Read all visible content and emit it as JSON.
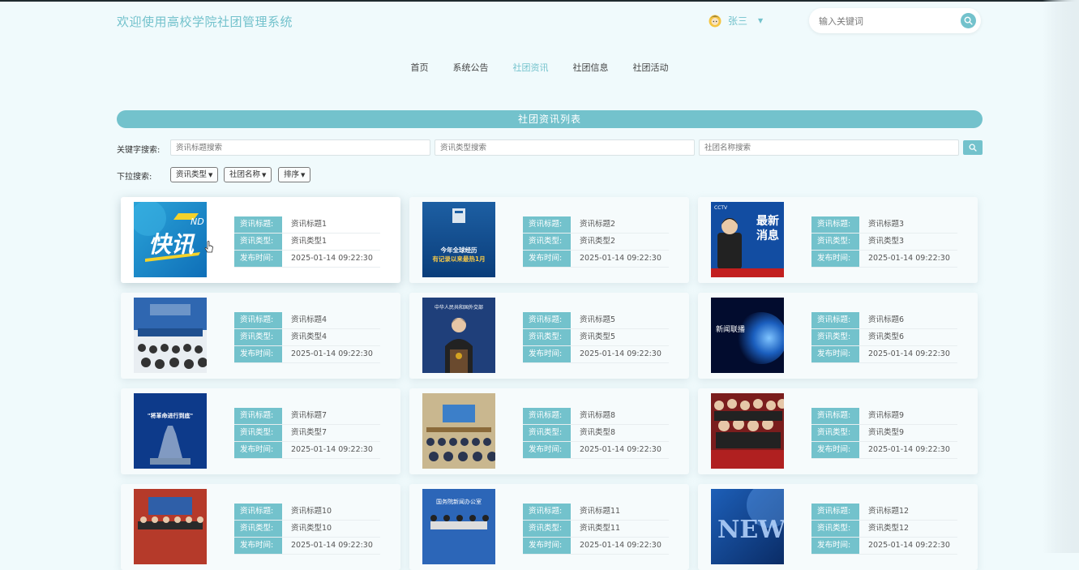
{
  "header": {
    "site_title": "欢迎使用高校学院社团管理系统",
    "user_name": "张三",
    "search_placeholder": "输入关键词"
  },
  "nav": {
    "items": [
      "首页",
      "系统公告",
      "社团资讯",
      "社团信息",
      "社团活动"
    ],
    "active": "社团资讯"
  },
  "section_title": "社团资讯列表",
  "filters": {
    "keyword_label": "关键字搜索:",
    "title_placeholder": "资讯标题搜索",
    "type_placeholder": "资讯类型搜索",
    "club_placeholder": "社团名称搜索",
    "dropdown_label": "下拉搜索:",
    "dropdowns": [
      "资讯类型",
      "社团名称",
      "排序"
    ]
  },
  "labels": {
    "title": "资讯标题:",
    "type": "资讯类型:",
    "time": "发布时间:"
  },
  "news": [
    {
      "title": "资讯标题1",
      "type": "资讯类型1",
      "time": "2025-01-14 09:22:30",
      "thumb_text": "快讯",
      "thumb_sub": "ND"
    },
    {
      "title": "资讯标题2",
      "type": "资讯类型2",
      "time": "2025-01-14 09:22:30",
      "thumb_text": "今年全球经历\n有记录以来最热1月"
    },
    {
      "title": "资讯标题3",
      "type": "资讯类型3",
      "time": "2025-01-14 09:22:30",
      "thumb_text": "最新\n消息",
      "thumb_sub": "CCTV"
    },
    {
      "title": "资讯标题4",
      "type": "资讯类型4",
      "time": "2025-01-14 09:22:30"
    },
    {
      "title": "资讯标题5",
      "type": "资讯类型5",
      "time": "2025-01-14 09:22:30",
      "thumb_text": "中华人民共和国外交部"
    },
    {
      "title": "资讯标题6",
      "type": "资讯类型6",
      "time": "2025-01-14 09:22:30",
      "thumb_text": "新闻联播"
    },
    {
      "title": "资讯标题7",
      "type": "资讯类型7",
      "time": "2025-01-14 09:22:30",
      "thumb_text": "\"将革命进行到底\""
    },
    {
      "title": "资讯标题8",
      "type": "资讯类型8",
      "time": "2025-01-14 09:22:30"
    },
    {
      "title": "资讯标题9",
      "type": "资讯类型9",
      "time": "2025-01-14 09:22:30"
    },
    {
      "title": "资讯标题10",
      "type": "资讯类型10",
      "time": "2025-01-14 09:22:30"
    },
    {
      "title": "资讯标题11",
      "type": "资讯类型11",
      "time": "2025-01-14 09:22:30",
      "thumb_text": "国务院新闻办公室"
    },
    {
      "title": "资讯标题12",
      "type": "资讯类型12",
      "time": "2025-01-14 09:22:30",
      "thumb_text": "NEW"
    }
  ],
  "colors": {
    "accent": "#73c2cc",
    "background": "#f0fafc"
  }
}
